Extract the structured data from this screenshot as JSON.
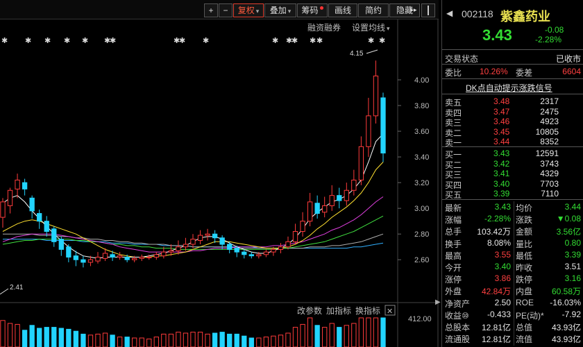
{
  "toolbar": {
    "plus": "+",
    "minus": "−",
    "fuquan": "复权",
    "diejia": "叠加",
    "chouma": "筹码",
    "huaxian": "画线",
    "jianyue": "简约",
    "yincang": "隐藏",
    "more": "▸▸"
  },
  "subbar": {
    "rongzi": "融资融券",
    "set_ma": "设置均线"
  },
  "chart": {
    "y_ticks": [
      "4.00",
      "3.80",
      "3.60",
      "3.40",
      "3.20",
      "3.00",
      "2.80",
      "2.60"
    ],
    "high_annotation": "4.15",
    "low_annotation": "2.41",
    "volume_tick": "412.00",
    "vol_menu": {
      "param": "改参数",
      "add": "加指标",
      "switch": "换指标",
      "close": "✕"
    },
    "colors": {
      "up": "#ff3b3b",
      "down": "#22d4ff",
      "ma5": "#ffffff",
      "ma10": "#ffe030",
      "ma20": "#e040e0",
      "ma30": "#40e040",
      "ma60": "#b0b0b0",
      "ma120": "#30b0ff"
    }
  },
  "chart_data": {
    "type": "candlestick",
    "ylim": [
      2.45,
      4.2
    ],
    "candles": [
      [
        2.93,
        3.05,
        2.85,
        3.08
      ],
      [
        3.02,
        3.14,
        2.96,
        3.16
      ],
      [
        3.15,
        3.22,
        3.08,
        3.27
      ],
      [
        3.2,
        3.15,
        3.1,
        3.23
      ],
      [
        3.08,
        2.98,
        2.92,
        3.1
      ],
      [
        2.96,
        2.9,
        2.84,
        2.99
      ],
      [
        2.9,
        2.82,
        2.78,
        2.94
      ],
      [
        2.84,
        2.74,
        2.7,
        2.86
      ],
      [
        2.76,
        2.68,
        2.63,
        2.78
      ],
      [
        2.7,
        2.62,
        2.58,
        2.72
      ],
      [
        2.63,
        2.6,
        2.55,
        2.67
      ],
      [
        2.6,
        2.58,
        2.54,
        2.63
      ],
      [
        2.58,
        2.6,
        2.55,
        2.63
      ],
      [
        2.59,
        2.62,
        2.57,
        2.66
      ],
      [
        2.61,
        2.65,
        2.59,
        2.69
      ],
      [
        2.64,
        2.62,
        2.59,
        2.67
      ],
      [
        2.62,
        2.63,
        2.6,
        2.66
      ],
      [
        2.62,
        2.6,
        2.58,
        2.64
      ],
      [
        2.6,
        2.61,
        2.58,
        2.63
      ],
      [
        2.61,
        2.62,
        2.59,
        2.64
      ],
      [
        2.62,
        2.62,
        2.6,
        2.64
      ],
      [
        2.62,
        2.64,
        2.6,
        2.66
      ],
      [
        2.63,
        2.66,
        2.61,
        2.7
      ],
      [
        2.66,
        2.67,
        2.63,
        2.72
      ],
      [
        2.67,
        2.7,
        2.64,
        2.75
      ],
      [
        2.7,
        2.72,
        2.67,
        2.77
      ],
      [
        2.72,
        2.76,
        2.69,
        2.8
      ],
      [
        2.75,
        2.79,
        2.72,
        2.83
      ],
      [
        2.79,
        2.8,
        2.75,
        2.84
      ],
      [
        2.8,
        2.77,
        2.73,
        2.83
      ],
      [
        2.77,
        2.72,
        2.68,
        2.79
      ],
      [
        2.72,
        2.68,
        2.65,
        2.74
      ],
      [
        2.69,
        2.66,
        2.62,
        2.71
      ],
      [
        2.66,
        2.64,
        2.61,
        2.68
      ],
      [
        2.64,
        2.63,
        2.61,
        2.66
      ],
      [
        2.63,
        2.64,
        2.61,
        2.66
      ],
      [
        2.64,
        2.66,
        2.62,
        2.68
      ],
      [
        2.66,
        2.68,
        2.63,
        2.7
      ],
      [
        2.68,
        2.7,
        2.65,
        2.73
      ],
      [
        2.7,
        2.74,
        2.68,
        2.78
      ],
      [
        2.74,
        2.82,
        2.72,
        2.88
      ],
      [
        2.82,
        2.9,
        2.78,
        2.97
      ],
      [
        2.9,
        3.05,
        2.86,
        3.12
      ],
      [
        3.04,
        2.96,
        2.92,
        3.1
      ],
      [
        2.97,
        3.02,
        2.93,
        3.09
      ],
      [
        3.02,
        3.1,
        2.98,
        3.18
      ],
      [
        3.1,
        3.06,
        3.0,
        3.16
      ],
      [
        3.06,
        3.14,
        3.02,
        3.2
      ],
      [
        3.14,
        3.22,
        3.1,
        3.3
      ],
      [
        3.22,
        3.48,
        3.18,
        3.56
      ],
      [
        3.48,
        3.72,
        3.4,
        3.86
      ],
      [
        3.72,
        4.03,
        3.66,
        4.15
      ],
      [
        3.86,
        3.43,
        3.36,
        3.9
      ]
    ],
    "ma5": [
      3.04,
      3.08,
      3.1,
      3.05,
      2.98,
      2.92,
      2.86,
      2.8,
      2.75,
      2.7,
      2.66,
      2.63,
      2.62,
      2.61,
      2.62,
      2.62,
      2.62,
      2.62,
      2.62,
      2.62,
      2.63,
      2.64,
      2.65,
      2.67,
      2.69,
      2.71,
      2.74,
      2.77,
      2.78,
      2.78,
      2.76,
      2.73,
      2.7,
      2.68,
      2.66,
      2.65,
      2.65,
      2.67,
      2.69,
      2.72,
      2.77,
      2.84,
      2.92,
      2.97,
      3.01,
      3.05,
      3.07,
      3.1,
      3.15,
      3.22,
      3.36,
      3.52,
      3.58
    ],
    "ma10": [
      2.82,
      2.85,
      2.88,
      2.9,
      2.91,
      2.9,
      2.88,
      2.86,
      2.84,
      2.82,
      2.8,
      2.77,
      2.74,
      2.71,
      2.68,
      2.66,
      2.64,
      2.63,
      2.62,
      2.62,
      2.62,
      2.63,
      2.63,
      2.64,
      2.65,
      2.66,
      2.68,
      2.7,
      2.72,
      2.74,
      2.74,
      2.74,
      2.73,
      2.72,
      2.71,
      2.7,
      2.69,
      2.69,
      2.69,
      2.7,
      2.72,
      2.75,
      2.79,
      2.84,
      2.88,
      2.93,
      2.97,
      3.01,
      3.06,
      3.12,
      3.2,
      3.3,
      3.36
    ],
    "ma20": [
      2.74,
      2.76,
      2.78,
      2.79,
      2.8,
      2.8,
      2.8,
      2.8,
      2.79,
      2.78,
      2.77,
      2.76,
      2.75,
      2.74,
      2.73,
      2.72,
      2.7,
      2.69,
      2.68,
      2.67,
      2.66,
      2.66,
      2.66,
      2.66,
      2.66,
      2.66,
      2.67,
      2.67,
      2.68,
      2.69,
      2.69,
      2.69,
      2.7,
      2.7,
      2.7,
      2.7,
      2.7,
      2.71,
      2.71,
      2.72,
      2.73,
      2.74,
      2.76,
      2.78,
      2.8,
      2.83,
      2.85,
      2.88,
      2.91,
      2.95,
      3.0,
      3.05,
      3.09
    ],
    "ma30": [
      2.72,
      2.73,
      2.74,
      2.75,
      2.75,
      2.76,
      2.76,
      2.76,
      2.76,
      2.76,
      2.75,
      2.75,
      2.74,
      2.74,
      2.73,
      2.72,
      2.72,
      2.71,
      2.71,
      2.7,
      2.7,
      2.69,
      2.69,
      2.69,
      2.68,
      2.68,
      2.68,
      2.68,
      2.68,
      2.68,
      2.68,
      2.68,
      2.68,
      2.68,
      2.68,
      2.68,
      2.68,
      2.68,
      2.69,
      2.69,
      2.7,
      2.71,
      2.72,
      2.73,
      2.74,
      2.76,
      2.78,
      2.8,
      2.82,
      2.85,
      2.88,
      2.91,
      2.94
    ],
    "ma60": [
      2.8,
      2.8,
      2.8,
      2.8,
      2.8,
      2.79,
      2.79,
      2.79,
      2.78,
      2.78,
      2.77,
      2.77,
      2.76,
      2.76,
      2.75,
      2.75,
      2.74,
      2.74,
      2.73,
      2.73,
      2.72,
      2.72,
      2.72,
      2.71,
      2.71,
      2.71,
      2.7,
      2.7,
      2.7,
      2.7,
      2.7,
      2.7,
      2.69,
      2.69,
      2.69,
      2.69,
      2.69,
      2.69,
      2.69,
      2.69,
      2.69,
      2.69,
      2.7,
      2.7,
      2.7,
      2.71,
      2.71,
      2.72,
      2.73,
      2.74,
      2.76,
      2.78,
      2.8
    ],
    "ma120": [
      2.76,
      2.76,
      2.76,
      2.76,
      2.76,
      2.76,
      2.75,
      2.75,
      2.75,
      2.75,
      2.75,
      2.74,
      2.74,
      2.74,
      2.74,
      2.73,
      2.73,
      2.73,
      2.72,
      2.72,
      2.72,
      2.72,
      2.71,
      2.71,
      2.71,
      2.71,
      2.7,
      2.7,
      2.7,
      2.7,
      2.7,
      2.7,
      2.7,
      2.7,
      2.7,
      2.69,
      2.69,
      2.69,
      2.69,
      2.69,
      2.69,
      2.69,
      2.69,
      2.69,
      2.69,
      2.69,
      2.69,
      2.69,
      2.7,
      2.7,
      2.71,
      2.72,
      2.73
    ]
  },
  "panel": {
    "code": "002118",
    "name": "紫鑫药业",
    "price": "3.43",
    "change": "-0.08",
    "change_pct": "-2.28%",
    "status_label": "交易状态",
    "status_value": "已收市",
    "weibi_label": "委比",
    "weibi_value": "10.26%",
    "weicha_label": "委差",
    "weicha_value": "6604",
    "dk_signal": "DK点自动提示涨跌信号",
    "asks": [
      {
        "label": "卖五",
        "price": "3.48",
        "vol": "2317"
      },
      {
        "label": "卖四",
        "price": "3.47",
        "vol": "2475"
      },
      {
        "label": "卖三",
        "price": "3.46",
        "vol": "4923"
      },
      {
        "label": "卖二",
        "price": "3.45",
        "vol": "10805"
      },
      {
        "label": "卖一",
        "price": "3.44",
        "vol": "8352"
      }
    ],
    "bids": [
      {
        "label": "买一",
        "price": "3.43",
        "vol": "12591"
      },
      {
        "label": "买二",
        "price": "3.42",
        "vol": "3743"
      },
      {
        "label": "买三",
        "price": "3.41",
        "vol": "4329"
      },
      {
        "label": "买四",
        "price": "3.40",
        "vol": "7703"
      },
      {
        "label": "买五",
        "price": "3.39",
        "vol": "7110"
      }
    ],
    "stats": [
      {
        "l1": "最新",
        "v1": "3.43",
        "c1": "green",
        "l2": "均价",
        "v2": "3.44",
        "c2": "green"
      },
      {
        "l1": "涨幅",
        "v1": "-2.28%",
        "c1": "green",
        "l2": "涨跌",
        "v2": "▼0.08",
        "c2": "green"
      },
      {
        "l1": "总手",
        "v1": "103.42万",
        "c1": "white",
        "l2": "金额",
        "v2": "3.56亿",
        "c2": "green"
      },
      {
        "l1": "换手",
        "v1": "8.08%",
        "c1": "white",
        "l2": "量比",
        "v2": "0.80",
        "c2": "green"
      },
      {
        "l1": "最高",
        "v1": "3.55",
        "c1": "red",
        "l2": "最低",
        "v2": "3.39",
        "c2": "green"
      },
      {
        "l1": "今开",
        "v1": "3.40",
        "c1": "green",
        "l2": "昨收",
        "v2": "3.51",
        "c2": "white"
      },
      {
        "l1": "涨停",
        "v1": "3.86",
        "c1": "red",
        "l2": "跌停",
        "v2": "3.16",
        "c2": "green"
      },
      {
        "l1": "外盘",
        "v1": "42.84万",
        "c1": "red",
        "l2": "内盘",
        "v2": "60.58万",
        "c2": "green"
      },
      {
        "l1": "净资产",
        "v1": "2.50",
        "c1": "white",
        "l2": "ROE",
        "v2": "-16.03%",
        "c2": "white"
      },
      {
        "l1": "收益⑩",
        "v1": "-0.433",
        "c1": "white",
        "l2": "PE(动)*",
        "v2": "-7.92",
        "c2": "white"
      },
      {
        "l1": "总股本",
        "v1": "12.81亿",
        "c1": "white",
        "l2": "总值",
        "v2": "43.93亿",
        "c2": "white"
      },
      {
        "l1": "流通股",
        "v1": "12.81亿",
        "c1": "white",
        "l2": "流值",
        "v2": "43.93亿",
        "c2": "white"
      }
    ]
  }
}
